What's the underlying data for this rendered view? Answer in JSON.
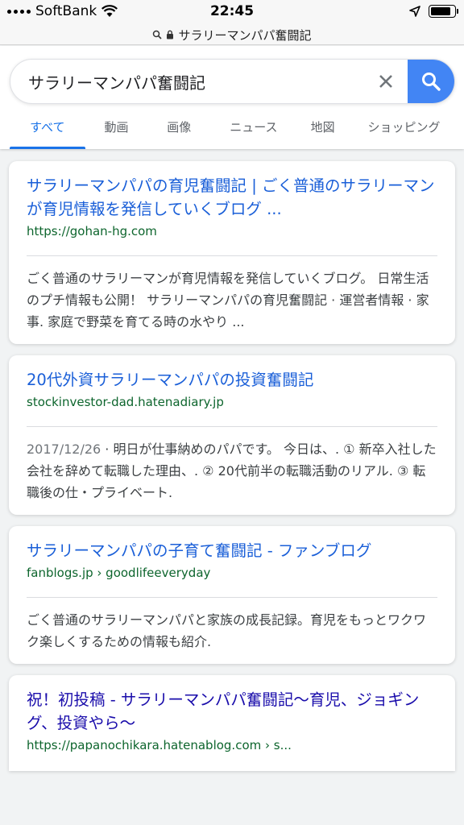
{
  "status_bar": {
    "carrier": "SoftBank",
    "time": "22:45"
  },
  "url_bar": {
    "text": "サラリーマンパパ奮闘記"
  },
  "search": {
    "query": "サラリーマンパパ奮闘記"
  },
  "tabs": [
    {
      "label": "すべて"
    },
    {
      "label": "動画"
    },
    {
      "label": "画像"
    },
    {
      "label": "ニュース"
    },
    {
      "label": "地図"
    },
    {
      "label": "ショッピング"
    }
  ],
  "results": [
    {
      "title": "サラリーマンパパの育児奮闘記 | ごく普通のサラリーマンが育児情報を発信していくブログ ...",
      "url": "https://gohan-hg.com",
      "snippet": "ごく普通のサラリーマンが育児情報を発信していくブログ。 日常生活のプチ情報も公開！ サラリーマンパパの育児奮闘記 · 運営者情報 · 家事. 家庭で野菜を育てる時の水やり ..."
    },
    {
      "title": "20代外資サラリーマンパパの投資奮闘記",
      "url": "stockinvestor-dad.hatenadiary.jp",
      "date": "2017/12/26",
      "snippet": " · 明日が仕事納めのパパです。 今日は、. ① 新卒入社した会社を辞めて転職した理由、. ② 20代前半の転職活動のリアル. ③ 転職後の仕・プライベート."
    },
    {
      "title": "サラリーマンパパの子育て奮闘記 - ファンブログ",
      "url": "fanblogs.jp › goodlifeeveryday",
      "snippet": "ごく普通のサラリーマンパパと家族の成長記録。育児をもっとワクワク楽しくするための情報も紹介."
    },
    {
      "title": "祝！初投稿 - サラリーマンパパ奮闘記〜育児、ジョギング、投資やら〜",
      "url": "https://papanochikara.hatenablog.com › s..."
    }
  ]
}
